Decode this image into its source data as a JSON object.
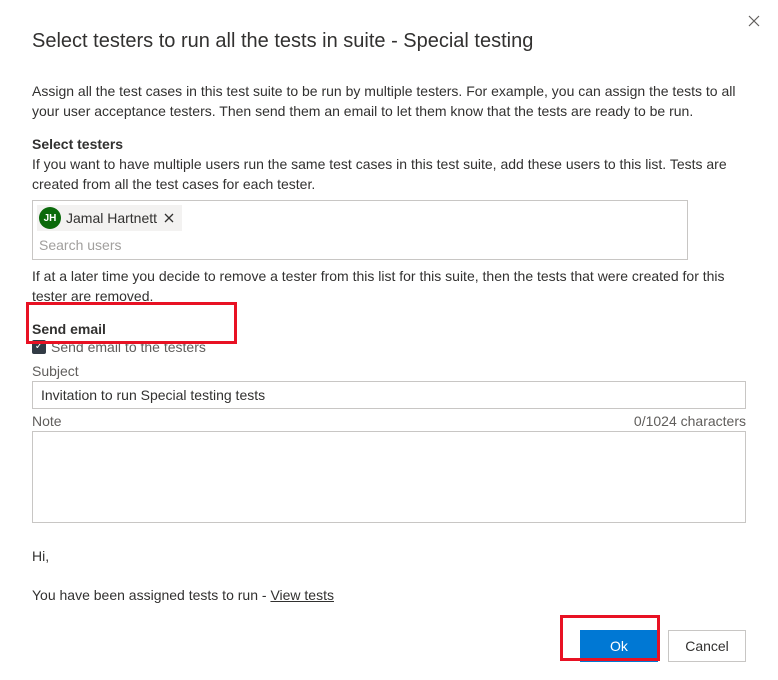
{
  "dialog": {
    "title": "Select testers to run all the tests in suite - Special testing",
    "intro": "Assign all the test cases in this test suite to be run by multiple testers. For example, you can assign the tests to all your user acceptance testers. Then send them an email to let them know that the tests are ready to be run."
  },
  "testers": {
    "heading": "Select testers",
    "help": "If you want to have multiple users run the same test cases in this test suite, add these users to this list. Tests are created from all the test cases for each tester.",
    "chips": [
      {
        "initials": "JH",
        "name": "Jamal Hartnett"
      }
    ],
    "search_placeholder": "Search users",
    "post_note": "If at a later time you decide to remove a tester from this list for this suite, then the tests that were created for this tester are removed."
  },
  "email": {
    "heading": "Send email",
    "checkbox_label": "Send email to the testers",
    "subject_label": "Subject",
    "subject_value": "Invitation to run Special testing tests",
    "note_label": "Note",
    "note_counter": "0/1024 characters",
    "note_value": "",
    "preview_greeting": "Hi,",
    "preview_body": "You have been assigned tests to run - ",
    "preview_link": "View tests"
  },
  "buttons": {
    "ok": "Ok",
    "cancel": "Cancel"
  }
}
